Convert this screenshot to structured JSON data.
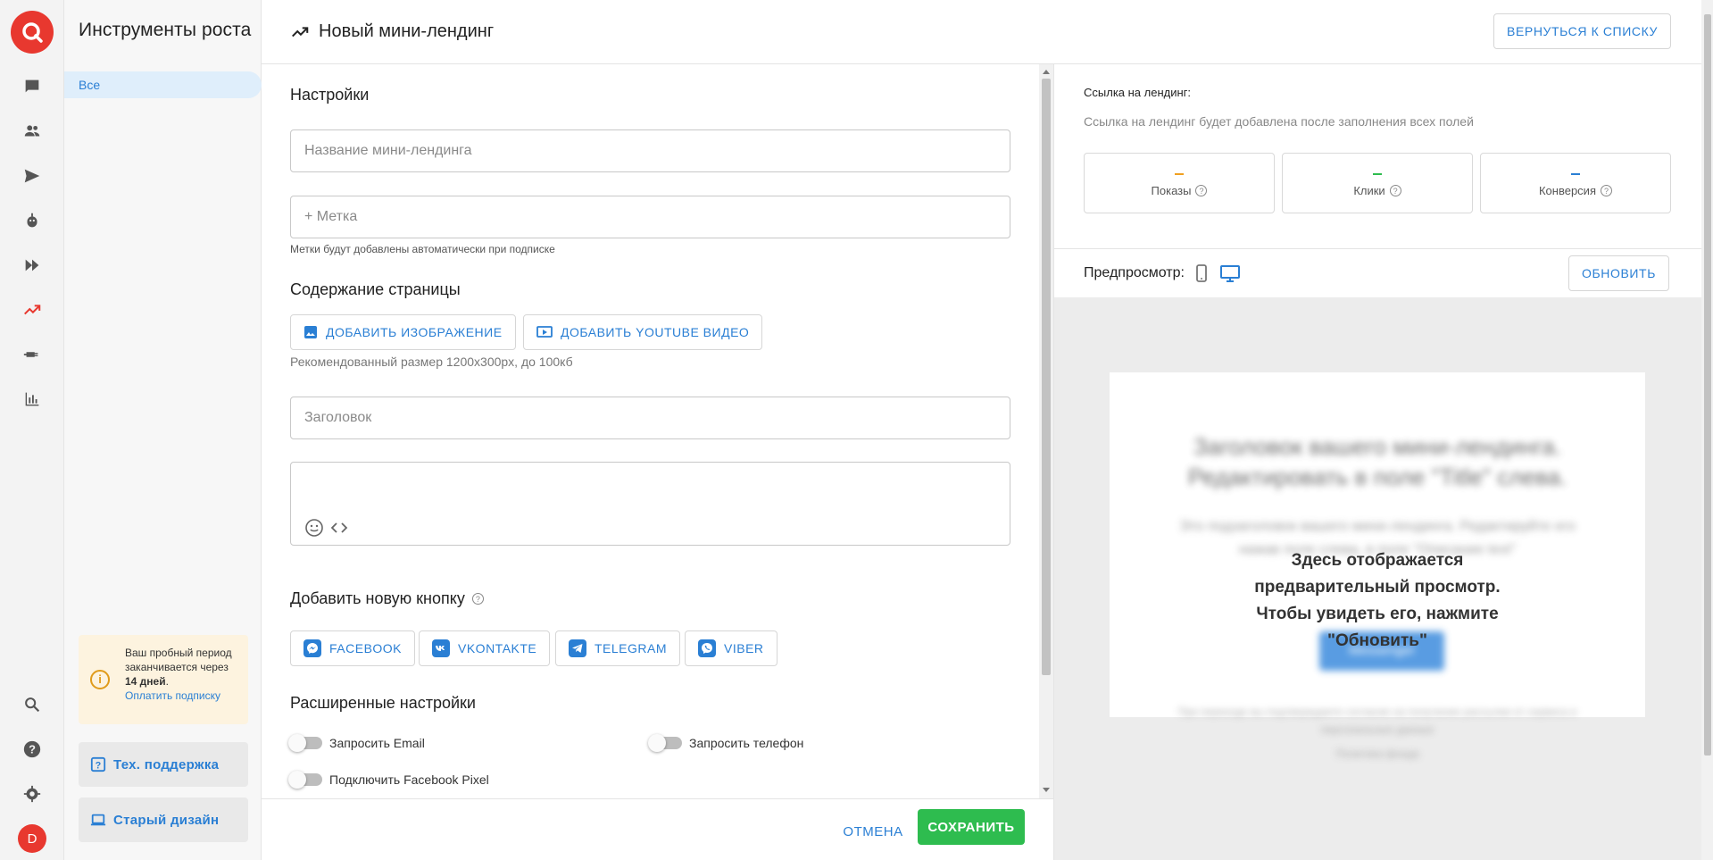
{
  "sidebar": {
    "title": "Инструменты роста",
    "nav_all": "Все",
    "trial": {
      "line1": "Ваш пробный период заканчивается через",
      "days": "14 дней",
      "dot": ".",
      "link": "Оплатить подписку"
    },
    "support_label": "Тех. поддержка",
    "old_design_label": "Старый дизайн"
  },
  "rail": {
    "avatar_letter": "D",
    "icons": [
      "chat-icon",
      "people-icon",
      "send-icon",
      "bot-icon",
      "fast-forward-icon",
      "trending-up-icon",
      "plug-icon",
      "bar-chart-icon",
      "search-icon",
      "help-icon",
      "gear-icon"
    ]
  },
  "header": {
    "title": "Новый мини-лендинг",
    "back_button": "ВЕРНУТЬСЯ К СПИСКУ"
  },
  "form": {
    "settings_title": "Настройки",
    "name_placeholder": "Название мини-лендинга",
    "tag_placeholder": "+  Метка",
    "tag_hint": "Метки будут добавлены автоматически при подписке",
    "content_title": "Содержание страницы",
    "add_image": "ДОБАВИТЬ ИЗОБРАЖЕНИЕ",
    "add_youtube": "ДОБАВИТЬ YOUTUBE ВИДЕО",
    "size_hint": "Рекомендованный размер 1200x300px, до 100кб",
    "heading_placeholder": "Заголовок",
    "add_button_title": "Добавить новую кнопку",
    "buttons": {
      "facebook": "FACEBOOK",
      "vkontakte": "VKONTAKTE",
      "telegram": "TELEGRAM",
      "viber": "VIBER"
    },
    "advanced_title": "Расширенные настройки",
    "request_email": "Запросить Email",
    "request_phone": "Запросить телефон",
    "facebook_pixel": "Подключить Facebook Pixel"
  },
  "actions": {
    "cancel": "ОТМЕНА",
    "save": "СОХРАНИТЬ"
  },
  "right": {
    "link_label": "Ссылка на лендинг:",
    "link_hint": "Ссылка на лендинг будет добавлена после заполнения всех полей",
    "stats": {
      "views": {
        "label": "Показы",
        "value": "—"
      },
      "clicks": {
        "label": "Клики",
        "value": "—"
      },
      "conversion": {
        "label": "Конверсия",
        "value": "—"
      }
    },
    "preview_label": "Предпросмотр:",
    "refresh_button": "ОБНОВИТЬ",
    "preview_card": {
      "blurred_title": "Заголовок вашего мини-лендинга. Редактировать в поле \"Title\" слева.",
      "blurred_subtitle": "Это подзаголовок вашего мини-лендинга. Редактируйте его нажав поле слева, в поле \"Описание text\"",
      "blurred_button": "Messenger",
      "blurred_footer": "При переходе вы подтверждаете согласие на получение рассылки от сервиса и персональные данные",
      "blurred_link": "Политика фонда",
      "message": "Здесь отображается предварительный просмотр. Чтобы увидеть его, нажмите \"Обновить\""
    }
  },
  "colors": {
    "accent": "#2a7fd4",
    "brand": "#e8382f",
    "save": "#2ebc4f",
    "views_dash": "#f0a020",
    "clicks_dash": "#2ebc4f",
    "conversion_dash": "#2a7fd4"
  }
}
